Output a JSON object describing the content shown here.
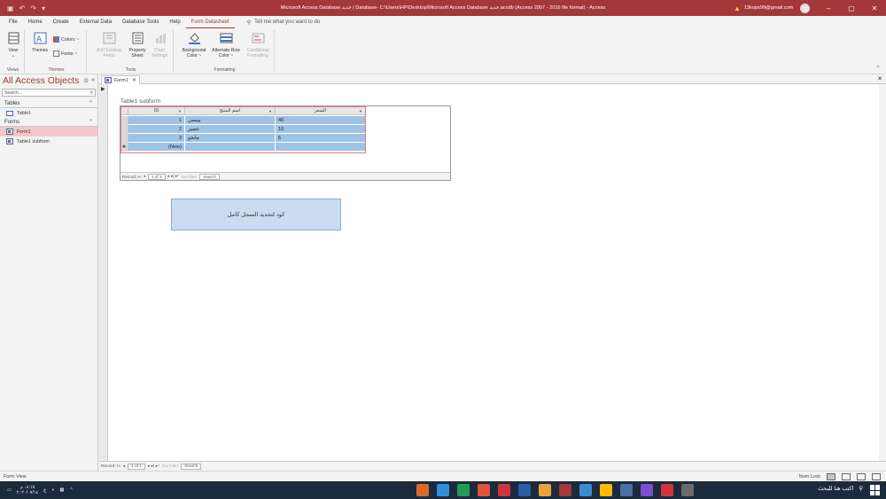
{
  "window": {
    "title": "Microsoft Access Database جديد | Database- C:\\Users\\HP\\Desktop\\Microsoft Access Database جديد.accdb (Access 2007 - 2016 file format)  -  Access",
    "account_email": "13kops99@gmail.com"
  },
  "ribbon_tabs": [
    "File",
    "Home",
    "Create",
    "External Data",
    "Database Tools",
    "Help",
    "Form Datasheet"
  ],
  "tell_me_placeholder": "Tell me what you want to do",
  "ribbon": {
    "views": {
      "view_label": "View",
      "group": "Views"
    },
    "themes": {
      "themes_label": "Themes",
      "colors_label": "Colors ~",
      "fonts_label": "Fonts ~",
      "group": "Themes"
    },
    "tools": {
      "add_existing_fields": "Add Existing Fields",
      "property_sheet": "Property Sheet",
      "chart_settings": "Chart Settings",
      "group": "Tools"
    },
    "formatting": {
      "background_color": "Background Color ~",
      "alternate_row_color": "Alternate Row Color ~",
      "conditional_formatting": "Conditional Formatting",
      "group": "Formatting"
    }
  },
  "nav": {
    "header": "All Access Objects",
    "search_placeholder": "Search...",
    "tables_section": "Tables",
    "tables": [
      "Table1"
    ],
    "forms_section": "Forms",
    "forms": [
      "Form1",
      "Table1 subform"
    ]
  },
  "document_tab": "Form1",
  "subform": {
    "label": "Table1 subform",
    "columns": [
      "ID",
      "اسم المنتج",
      "السعر"
    ],
    "rows": [
      {
        "id": "1",
        "name": "بيبسي",
        "price": "40"
      },
      {
        "id": "2",
        "name": "عصير",
        "price": "10"
      },
      {
        "id": "3",
        "name": "مانجو",
        "price": "6"
      }
    ],
    "new_row": "(New)",
    "record_nav": {
      "label": "Record: H",
      "position": "1 of 3",
      "controls": "▸ ▸| ▸*",
      "filter": "No Filter",
      "search": "Search"
    }
  },
  "command_button_label": "كود لتحديد السجل كامل",
  "form_record_nav": {
    "label": "Record: H",
    "position": "1 of 1",
    "controls": "▸ ▸| ▸*",
    "filter": "No Filter",
    "search": "Search"
  },
  "status": {
    "view": "Form View",
    "num_lock": "Num Lock"
  },
  "taskbar": {
    "clock_time": "٠٤:١٥ م",
    "clock_date": "٢٠٢٠/٠٧/١٤",
    "search_text": "اكتب هنا للبحث",
    "app_colors": [
      "#d86b2a",
      "#2f8fd8",
      "#1f9d55",
      "#e0533a",
      "#d13438",
      "#2c5ca8",
      "#e8a33d",
      "#a4373a",
      "#3b8bd4",
      "#ffb900",
      "#4a6fa5",
      "#7b4fd0",
      "#d13438",
      "#6a6a6a"
    ]
  }
}
